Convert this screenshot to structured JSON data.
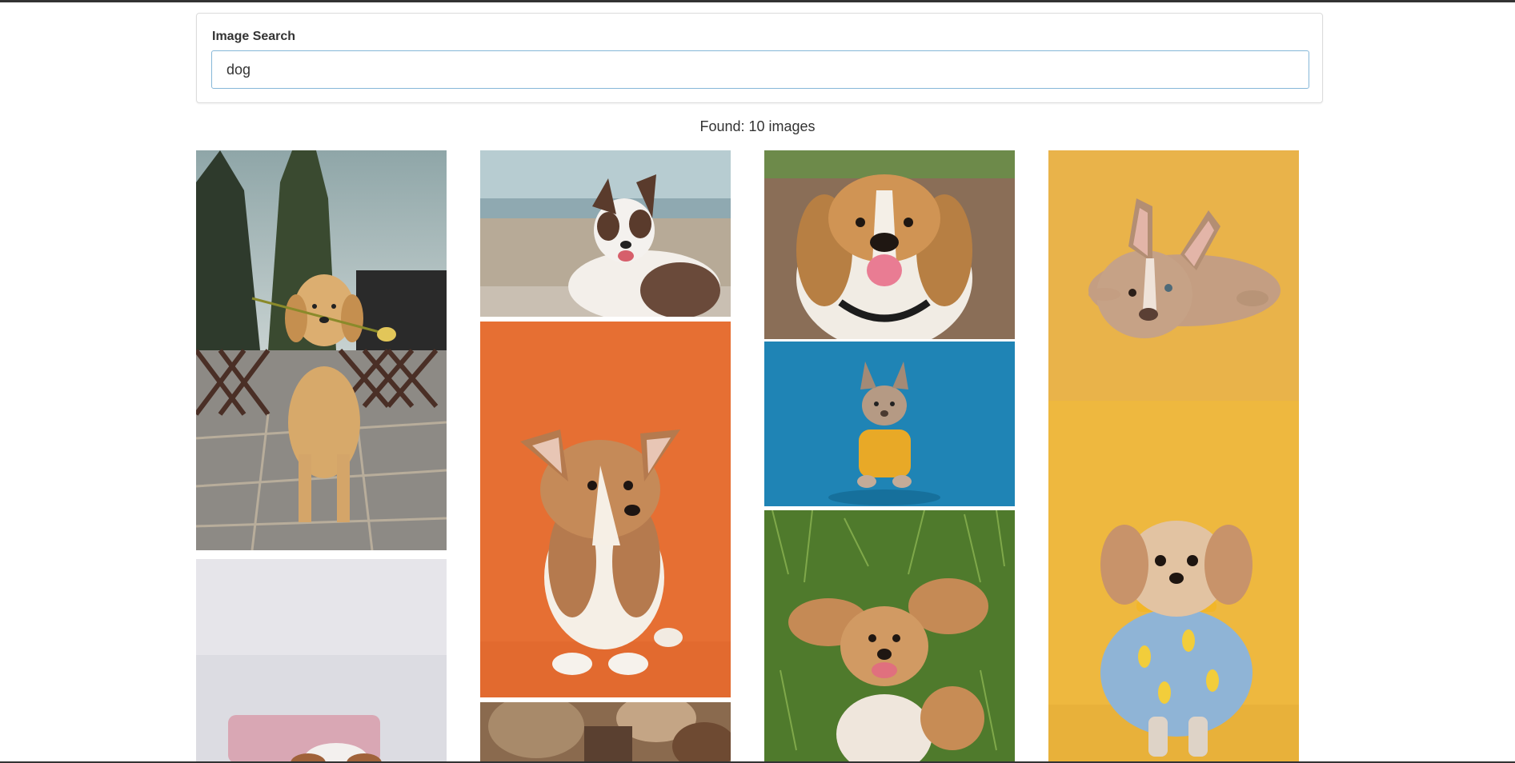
{
  "search": {
    "label": "Image Search",
    "value": "dog",
    "placeholder": ""
  },
  "results": {
    "count_text": "Found: 10 images"
  },
  "colors": {
    "input_border": "#86b7d8",
    "text": "#333333"
  }
}
